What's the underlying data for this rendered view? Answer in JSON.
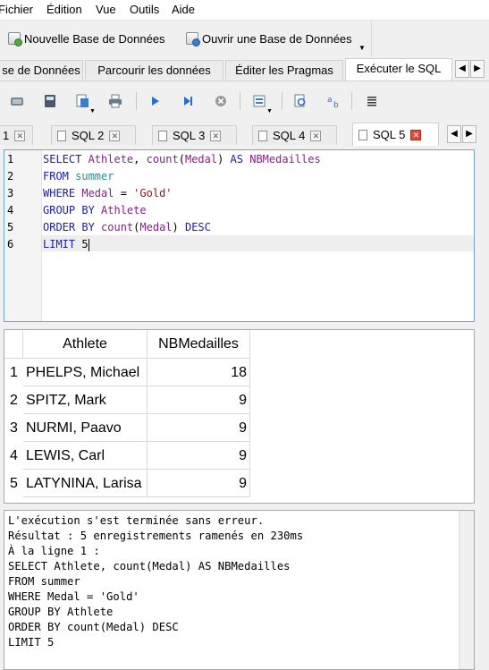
{
  "menu": [
    "Fichier",
    "Édition",
    "Vue",
    "Outils",
    "Aide"
  ],
  "toolbar": {
    "new_db": "Nouvelle Base de Données",
    "open_db": "Ouvrir une Base de Données"
  },
  "main_tabs": [
    "se de Données",
    "Parcourir les données",
    "Éditer les Pragmas",
    "Exécuter le SQL"
  ],
  "sql_tabs": [
    "1",
    "SQL 2",
    "SQL 3",
    "SQL 4",
    "SQL 5"
  ],
  "editor": {
    "line_numbers": [
      "1",
      "2",
      "3",
      "4",
      "5",
      "6"
    ],
    "lines": [
      [
        [
          "kw",
          "SELECT "
        ],
        [
          "id",
          "Athlete"
        ],
        [
          "",
          "",
          ""
        ],
        [
          "num",
          ", "
        ],
        [
          "fn",
          "count"
        ],
        [
          "num",
          "("
        ],
        [
          "id",
          "Medal"
        ],
        [
          "num",
          ") "
        ],
        [
          "kw",
          "AS "
        ],
        [
          "id",
          "NBMedailles"
        ]
      ],
      [
        [
          "kw",
          "FROM "
        ],
        [
          "tbl",
          "summer"
        ]
      ],
      [
        [
          "kw",
          "WHERE "
        ],
        [
          "id",
          "Medal"
        ],
        [
          "num",
          " = "
        ],
        [
          "str",
          "'Gold'"
        ]
      ],
      [
        [
          "kw",
          "GROUP BY "
        ],
        [
          "id",
          "Athlete"
        ]
      ],
      [
        [
          "kw",
          "ORDER BY "
        ],
        [
          "fn",
          "count"
        ],
        [
          "num",
          "("
        ],
        [
          "id",
          "Medal"
        ],
        [
          "num",
          ") "
        ],
        [
          "kw",
          "DESC"
        ]
      ],
      [
        [
          "kw",
          "LIMIT "
        ],
        [
          "num",
          "5"
        ]
      ]
    ]
  },
  "results": {
    "headers": [
      "Athlete",
      "NBMedailles"
    ],
    "rows": [
      {
        "n": "1",
        "athlete": "PHELPS, Michael",
        "count": "18"
      },
      {
        "n": "2",
        "athlete": "SPITZ, Mark",
        "count": "9"
      },
      {
        "n": "3",
        "athlete": "NURMI, Paavo",
        "count": "9"
      },
      {
        "n": "4",
        "athlete": "LEWIS, Carl",
        "count": "9"
      },
      {
        "n": "5",
        "athlete": "LATYNINA, Larisa",
        "count": "9"
      }
    ]
  },
  "log": [
    "L'exécution s'est terminée sans erreur.",
    "Résultat : 5 enregistrements ramenés en 230ms",
    "À la ligne 1 :",
    "SELECT Athlete, count(Medal) AS NBMedailles",
    "FROM summer",
    "WHERE Medal = 'Gold'",
    "GROUP BY Athlete",
    "ORDER BY count(Medal) DESC",
    "LIMIT 5"
  ],
  "colors": {
    "keyword": "#1c1ca8",
    "identifier": "#8c1c8c",
    "table": "#2c8a8a",
    "string": "#a01010",
    "editor_border": "#6aa7d8",
    "close_active": "#e04a3a"
  },
  "icons": [
    "new-db-icon",
    "open-db-icon",
    "open-sql-tab-icon",
    "open-sql-file-icon",
    "save-sql-icon",
    "print-icon",
    "execute-all-icon",
    "execute-line-icon",
    "stop-icon",
    "save-results-icon",
    "find-icon",
    "find-replace-icon",
    "comment-icon"
  ]
}
